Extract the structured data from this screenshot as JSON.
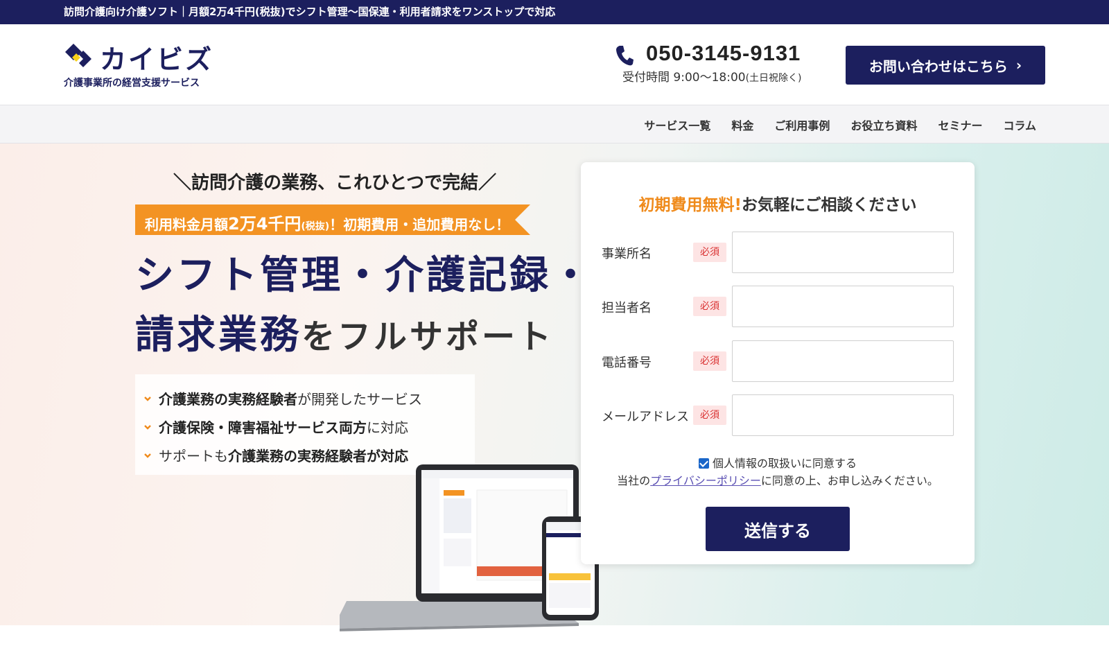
{
  "topbar": {
    "text": "訪問介護向け介護ソフト｜月額2万4千円(税抜)でシフト管理〜国保連・利用者請求をワンストップで対応"
  },
  "header": {
    "logo_name": "カイビズ",
    "logo_sub": "介護事業所の経営支援サービス",
    "phone_number": "050-3145-9131",
    "phone_hours": "受付時間 9:00〜18:00",
    "phone_hours_note": "(土日祝除く)",
    "contact_button": "お問い合わせはこちら",
    "contact_button_arrow": "›"
  },
  "nav": {
    "items": [
      {
        "label": "サービス一覧"
      },
      {
        "label": "料金"
      },
      {
        "label": "ご利用事例"
      },
      {
        "label": "お役立ち資料"
      },
      {
        "label": "セミナー"
      },
      {
        "label": "コラム"
      }
    ]
  },
  "hero": {
    "tagline": "＼訪問介護の業務、これひとつで完結／",
    "price_ribbon": {
      "part1": "利用料金月額",
      "amount": "2万4千円",
      "tax": "(税抜)",
      "part2": "！初期費用・追加費用なし！"
    },
    "headline_line1": "シフト管理・介護記録・",
    "headline_line2_mark": "請求業務",
    "headline_line2_rest": "をフルサポート",
    "features": [
      {
        "bold": "介護業務の実務経験者",
        "rest": "が開発したサービス"
      },
      {
        "bold": "介護保険・障害福祉サービス両方",
        "rest": "に対応"
      },
      {
        "pre": "サポートも",
        "bold": "介護業務の実務経験者が対応",
        "rest": ""
      }
    ]
  },
  "form": {
    "title_accent": "初期費用無料!",
    "title_rest": "お気軽にご相談ください",
    "required_label": "必須",
    "fields": [
      {
        "label": "事業所名",
        "value": ""
      },
      {
        "label": "担当者名",
        "value": ""
      },
      {
        "label": "電話番号",
        "value": ""
      },
      {
        "label": "メールアドレス",
        "value": ""
      }
    ],
    "consent_label": "個人情報の取扱いに同意する",
    "privacy_pre": "当社の",
    "privacy_link": "プライバシーポリシー",
    "privacy_post": "に同意の上、お申し込みください。",
    "submit": "送信する"
  },
  "colors": {
    "navy": "#1c1f5e",
    "orange": "#ef8a1b",
    "ribbon": "#f39323",
    "highlight": "#f8d119",
    "required_bg": "#fde4e4",
    "required_text": "#d93030"
  },
  "icons": {
    "phone": "phone-icon",
    "chevron": "chevron-down-icon",
    "logo": "logo-mark-icon"
  }
}
